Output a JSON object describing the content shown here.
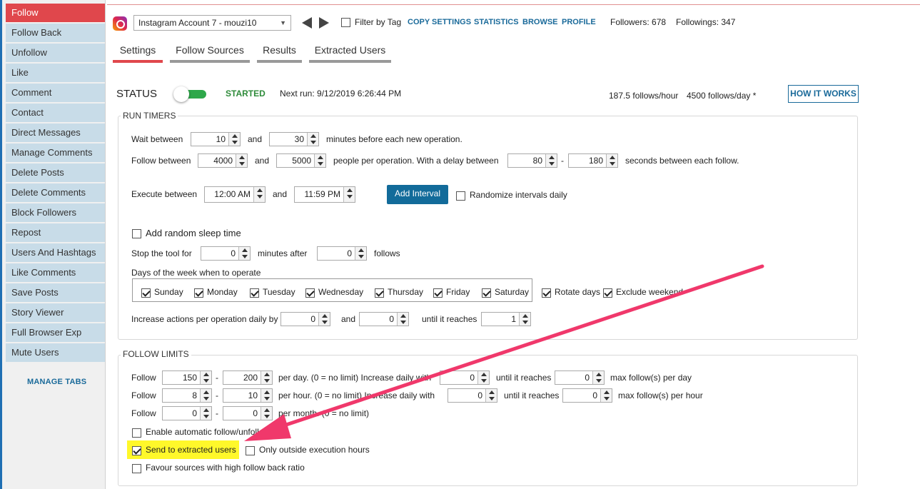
{
  "sidebar": {
    "items": [
      {
        "label": "Follow",
        "active": true
      },
      {
        "label": "Follow Back"
      },
      {
        "label": "Unfollow"
      },
      {
        "label": "Like"
      },
      {
        "label": "Comment"
      },
      {
        "label": "Contact"
      },
      {
        "label": "Direct Messages"
      },
      {
        "label": "Manage Comments"
      },
      {
        "label": "Delete Posts"
      },
      {
        "label": "Delete Comments"
      },
      {
        "label": "Block Followers"
      },
      {
        "label": "Repost"
      },
      {
        "label": "Users And Hashtags"
      },
      {
        "label": "Like Comments"
      },
      {
        "label": "Save Posts"
      },
      {
        "label": "Story Viewer"
      },
      {
        "label": "Full Browser Exp"
      },
      {
        "label": "Mute Users"
      }
    ],
    "manage_tabs": "MANAGE TABS"
  },
  "header": {
    "account": "Instagram Account 7 - mouzi10",
    "filter_by_tag": "Filter by Tag",
    "links": {
      "copy_settings": "COPY SETTINGS",
      "statistics": "STATISTICS",
      "browse": "BROWSE",
      "profile": "PROFILE"
    },
    "followers": "Followers: 678",
    "followings": "Followings: 347"
  },
  "tabs": {
    "settings": "Settings",
    "follow_sources": "Follow Sources",
    "results": "Results",
    "extracted_users": "Extracted Users"
  },
  "status": {
    "label": "STATUS",
    "state": "STARTED",
    "next_run": "Next run: 9/12/2019 6:26:44 PM",
    "rate_hour": "187.5 follows/hour",
    "rate_day": "4500 follows/day *",
    "how_it_works": "HOW IT WORKS"
  },
  "run_timers": {
    "title": "RUN TIMERS",
    "wait": {
      "label": "Wait between",
      "min": "10",
      "and": "and",
      "max": "30",
      "suffix": "minutes before each new operation."
    },
    "follow": {
      "label": "Follow between",
      "min": "4000",
      "and": "and",
      "max": "5000",
      "mid": "people per operation. With a delay between",
      "dmin": "80",
      "dash": "-",
      "dmax": "180",
      "suffix": "seconds between each follow."
    },
    "execute": {
      "label": "Execute between",
      "start": "12:00 AM",
      "and": "and",
      "end": "11:59 PM"
    },
    "add_interval": "Add Interval",
    "randomize": "Randomize intervals daily",
    "random_sleep": "Add random sleep time",
    "stop": {
      "label": "Stop the tool for",
      "minutes": "0",
      "mid": "minutes after",
      "follows": "0",
      "suffix": "follows"
    },
    "days_label": "Days of the week when to operate",
    "days": [
      "Sunday",
      "Monday",
      "Tuesday",
      "Wednesday",
      "Thursday",
      "Friday",
      "Saturday"
    ],
    "rotate_days": "Rotate days",
    "exclude_weekend": "Exclude weekend",
    "increase": {
      "label": "Increase actions per operation daily by",
      "by": "0",
      "and": "and",
      "v2": "0",
      "mid": "until it reaches",
      "reach": "1"
    }
  },
  "follow_limits": {
    "title": "FOLLOW LIMITS",
    "row1": {
      "label": "Follow",
      "min": "150",
      "dash": "-",
      "max": "200",
      "t1": "per day. (0 = no limit)  Increase daily with",
      "inc": "0",
      "t2": "until it reaches",
      "reach": "0",
      "t3": "max follow(s) per day"
    },
    "row2": {
      "label": "Follow",
      "min": "8",
      "dash": "-",
      "max": "10",
      "t1": "per hour. (0 = no limit)  Increase daily with",
      "inc": "0",
      "t2": "until it reaches",
      "reach": "0",
      "t3": "max follow(s) per hour"
    },
    "row3": {
      "label": "Follow",
      "min": "0",
      "dash": "-",
      "max": "0",
      "t1": "per month. (0 = no limit)"
    },
    "enable_auto": "Enable automatic follow/unfollow",
    "send_extracted": "Send to extracted users",
    "only_outside": "Only outside execution hours",
    "favour": "Favour sources with high follow back ratio"
  },
  "annotation": {
    "arrow_color": "#f0386b",
    "highlight_color": "#fff82a"
  }
}
